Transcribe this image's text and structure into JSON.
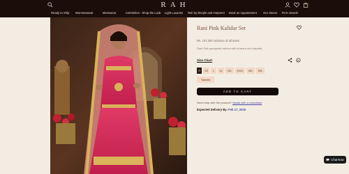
{
  "header": {
    "logo": "RAH",
    "nav": [
      "Ready to Ship",
      "Womenswear",
      "Menswear",
      "Celebrities - Shop the Look",
      "Light Luxuries",
      "Rah by Bimple and Harpreet",
      "Book an Appointment",
      "Our Stores",
      "RAH Jewels"
    ]
  },
  "product": {
    "title": "Rani Pink Kalidar Set",
    "price": "Rs. 137,200 inclusive of all taxes",
    "description": "Rani Pink georgette kalidar with sharara and dupatta",
    "size_chart_label": "Size Chart",
    "sizes": [
      "S",
      "XS",
      "L",
      "XL",
      "2XL",
      "3XXL",
      "4XL",
      "5XL"
    ],
    "selected_size": "S",
    "tailored_label": "Tailored",
    "add_to_cart_label": "ADD TO CART",
    "help_text": "Need help with the product?",
    "help_link": "Speak with a consultant",
    "delivery_label": "Expected Delivery By:",
    "delivery_date": "Feb 17, 2025"
  },
  "chat": {
    "label": "Chat Now"
  },
  "icons": [
    "search-icon",
    "user-icon",
    "heart-icon",
    "bag-icon",
    "share-icon",
    "whatsapp-icon",
    "chat-icon"
  ],
  "colors": {
    "header": "#1a0d0a",
    "background": "#f3ece3",
    "button": "#140a08",
    "size_chip": "#f1d9c6"
  }
}
